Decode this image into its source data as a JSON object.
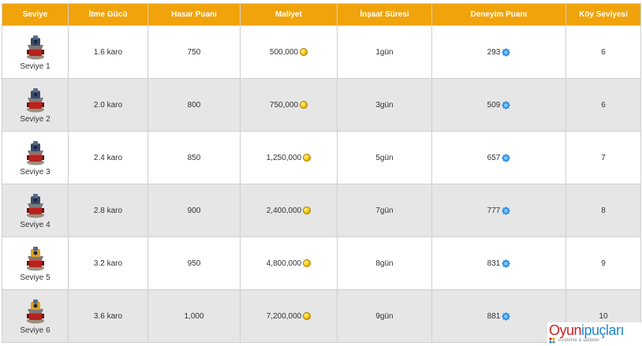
{
  "table": {
    "headers": [
      "Seviye",
      "İtme Gücü",
      "Hasar Puanı",
      "Maliyet",
      "İnşaat Süresi",
      "Deneyim Puanı",
      "Köy Seviyesi"
    ],
    "rows": [
      {
        "level": "Seviye 1",
        "push": "1.6 karo",
        "damage": "750",
        "cost": "500,000",
        "build_time": "1gün",
        "xp": "293",
        "town_level": "6"
      },
      {
        "level": "Seviye 2",
        "push": "2.0 karo",
        "damage": "800",
        "cost": "750,000",
        "build_time": "3gün",
        "xp": "509",
        "town_level": "6"
      },
      {
        "level": "Seviye 3",
        "push": "2.4 karo",
        "damage": "850",
        "cost": "1,250,000",
        "build_time": "5gün",
        "xp": "657",
        "town_level": "7"
      },
      {
        "level": "Seviye 4",
        "push": "2.8 karo",
        "damage": "900",
        "cost": "2,400,000",
        "build_time": "7gün",
        "xp": "777",
        "town_level": "8"
      },
      {
        "level": "Seviye 5",
        "push": "3.2 karo",
        "damage": "950",
        "cost": "4,800,000",
        "build_time": "8gün",
        "xp": "831",
        "town_level": "9"
      },
      {
        "level": "Seviye 6",
        "push": "3.6 karo",
        "damage": "1,000",
        "cost": "7,200,000",
        "build_time": "9gün",
        "xp": "881",
        "town_level": "10"
      }
    ]
  },
  "icons": {
    "level": "air-sweeper-tower-icon",
    "cost": "gold-coin-icon",
    "xp": "experience-star-icon"
  },
  "colors": {
    "header_bg": "#f0a30a",
    "header_text": "#ffffff",
    "row_alt_bg": "#e6e6e6",
    "coin": "#f2c200",
    "xp": "#2f8fe0"
  },
  "watermark": {
    "title_red": "Oyun",
    "title_blue": "ipuçları",
    "subtitle": "inceleme & taktikler"
  }
}
